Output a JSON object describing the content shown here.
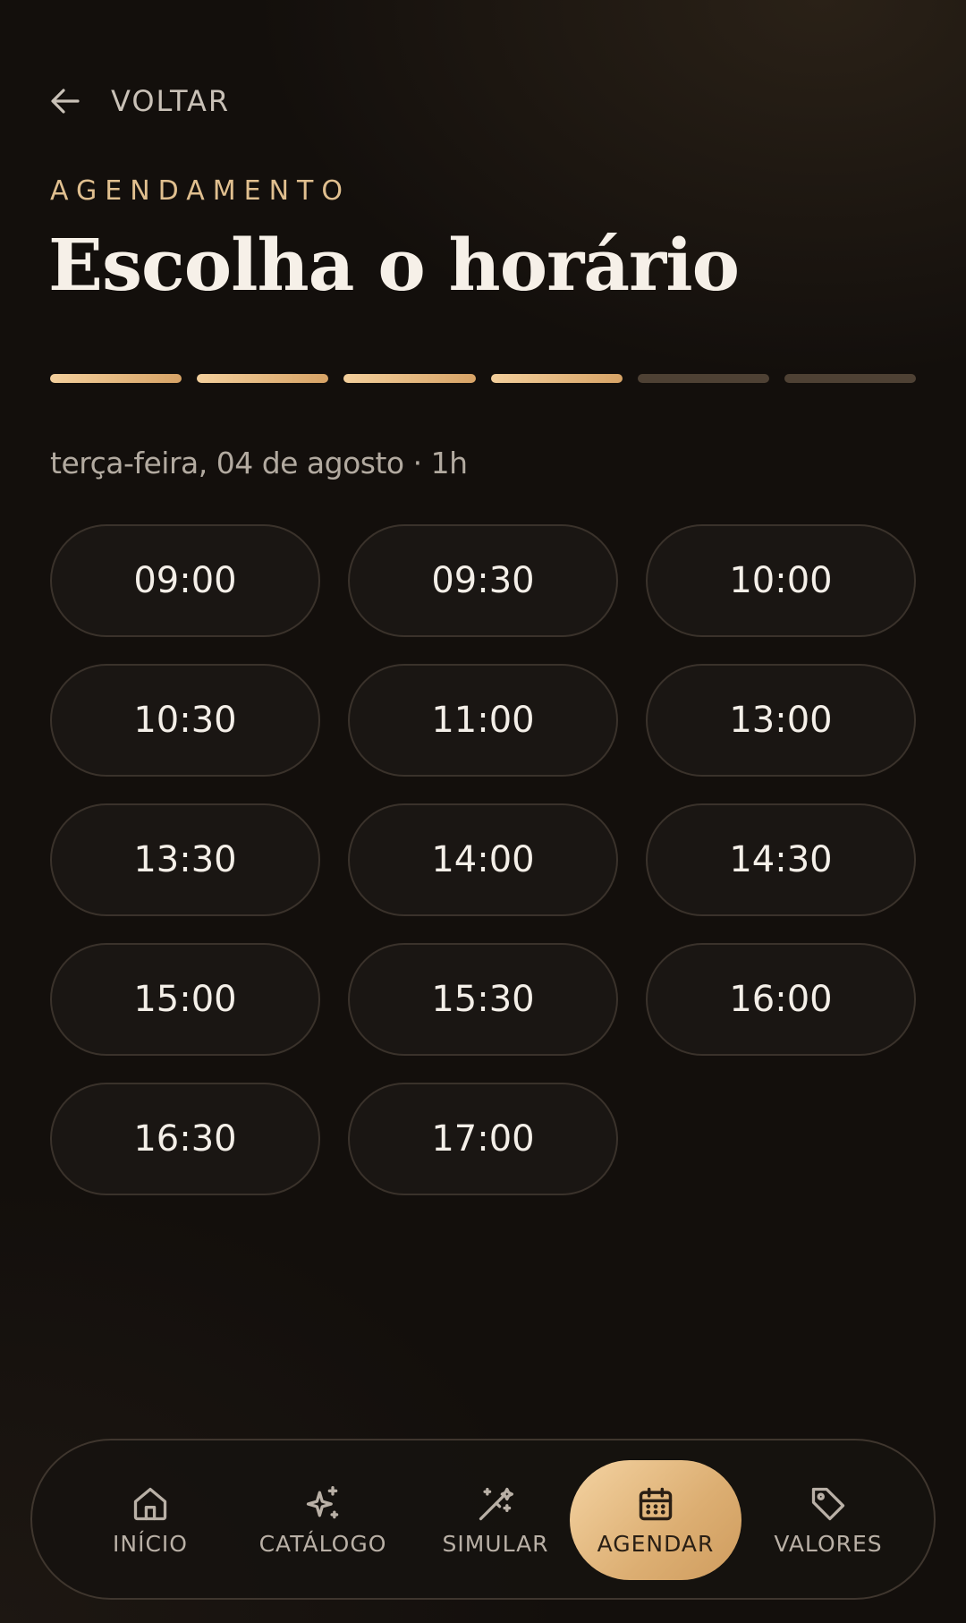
{
  "header": {
    "back_label": "VOLTAR",
    "eyebrow": "AGENDAMENTO",
    "title": "Escolha o horário"
  },
  "progress": {
    "total_steps": 6,
    "completed_steps": 4
  },
  "subtitle": "terça-feira, 04 de agosto · 1h",
  "slots": [
    "09:00",
    "09:30",
    "10:00",
    "10:30",
    "11:00",
    "13:00",
    "13:30",
    "14:00",
    "14:30",
    "15:00",
    "15:30",
    "16:00",
    "16:30",
    "17:00"
  ],
  "nav": {
    "items": [
      {
        "label": "INÍCIO",
        "icon": "home-icon",
        "active": false
      },
      {
        "label": "CATÁLOGO",
        "icon": "sparkles-icon",
        "active": false
      },
      {
        "label": "SIMULAR",
        "icon": "magic-wand-icon",
        "active": false
      },
      {
        "label": "AGENDAR",
        "icon": "calendar-icon",
        "active": true
      },
      {
        "label": "VALORES",
        "icon": "tag-icon",
        "active": false
      }
    ]
  },
  "colors": {
    "accent": "#e0bf8f",
    "active_nav_bg": "#dcae72",
    "background": "#130f0c"
  }
}
